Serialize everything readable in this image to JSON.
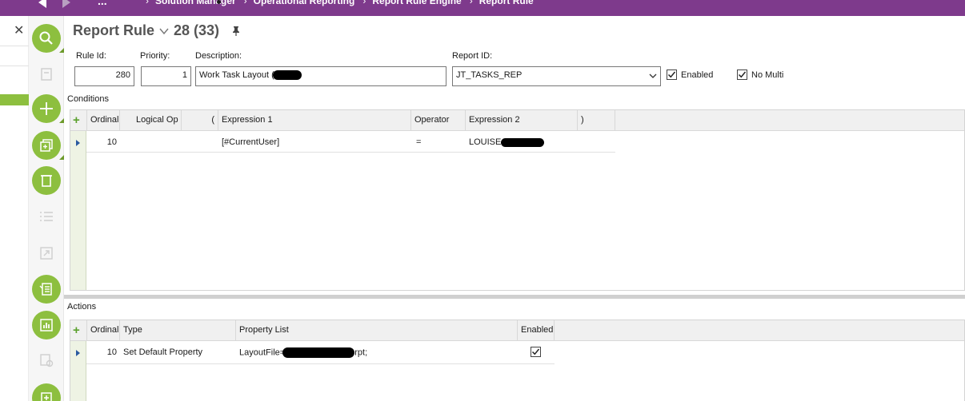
{
  "breadcrumb": [
    "Solution Manager",
    "Operational Reporting",
    "Report Rule Engine",
    "Report Rule"
  ],
  "header": {
    "title": "Report Rule",
    "record_count": "28 (33)"
  },
  "form": {
    "rule_id_label": "Rule Id:",
    "rule_id_value": "280",
    "priority_label": "Priority:",
    "priority_value": "1",
    "description_label": "Description:",
    "description_value": "Work Task Layout (",
    "report_id_label": "Report ID:",
    "report_id_value": "JT_TASKS_REP",
    "enabled_label": "Enabled",
    "enabled_checked": true,
    "no_multi_label": "No Multi",
    "no_multi_checked": true
  },
  "conditions": {
    "section_label": "Conditions",
    "columns": [
      "Ordinal",
      "Logical Op",
      "(",
      "Expression 1",
      "Operator",
      "Expression 2",
      ")"
    ],
    "rows": [
      {
        "ordinal": "10",
        "logical_op": "",
        "open_paren": "",
        "expression1": "[#CurrentUser]",
        "operator": "=",
        "expression2": "LOUISE",
        "close_paren": ""
      }
    ]
  },
  "actions": {
    "section_label": "Actions",
    "columns": [
      "Ordinal",
      "Type",
      "Property List",
      "Enabled"
    ],
    "rows": [
      {
        "ordinal": "10",
        "type": "Set Default Property",
        "property_prefix": "LayoutFile=",
        "property_suffix": ".rpt;",
        "enabled": true
      }
    ]
  },
  "colors": {
    "topbar": "#7e3a8c",
    "accent_green": "#8dbf3f"
  },
  "icons": [
    "search-icon",
    "add-icon",
    "duplicate-icon",
    "delete-icon",
    "list-icon",
    "open-icon",
    "details-icon",
    "analytics-icon",
    "report-icon",
    "pin-icon",
    "close-icon"
  ]
}
